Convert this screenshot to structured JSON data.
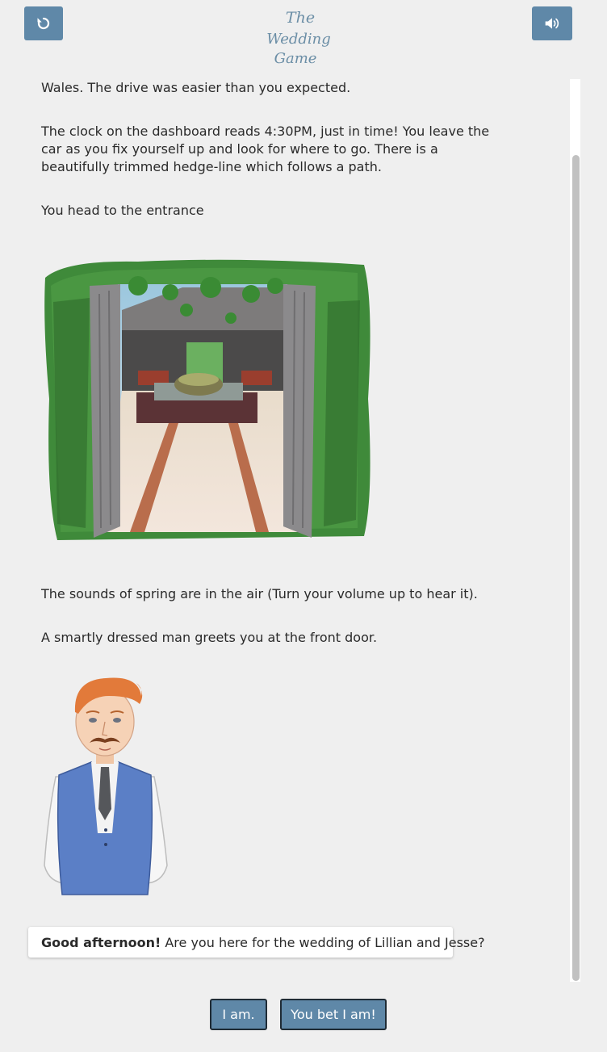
{
  "header": {
    "restart_icon": "restart-icon",
    "sound_icon": "speaker-volume-icon",
    "logo_lines": [
      "The",
      "Wedding",
      "Game"
    ]
  },
  "story": {
    "p1": "Wales. The drive was easier than you expected.",
    "p2": "The clock on the dashboard reads 4:30PM, just in time! You leave the car as you fix yourself up and look for where to go. There is a beautifully trimmed hedge-line which follows a path.",
    "p3": "You head to the entrance",
    "p4": "The sounds of spring are in the air (Turn your volume up to hear it).",
    "p5": "A smartly dressed man greets you at the front door."
  },
  "dialog": {
    "greeting": "Good afternoon!",
    "text": "Are you here for the wedding of Lillian and Jesse?"
  },
  "choices": {
    "choice1": "I am.",
    "choice2": "You bet I am!"
  },
  "colors": {
    "button": "#5f88a8",
    "background": "#efefef"
  }
}
